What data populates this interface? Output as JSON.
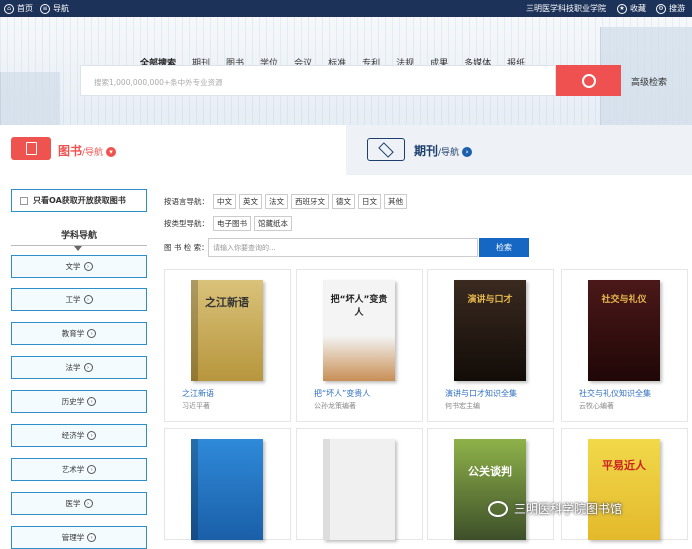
{
  "topbar": {
    "home": "首页",
    "nav": "导航",
    "school": "三明医学科技职业学院",
    "favorite": "收藏",
    "shortcut": "搜游"
  },
  "search": {
    "categories": [
      "全部搜索",
      "期刊",
      "图书",
      "学位",
      "会议",
      "标准",
      "专利",
      "法规",
      "成果",
      "多媒体",
      "报纸"
    ],
    "placeholder": "搜索1,000,000,000+条中外专业资源",
    "advanced": "高级检索"
  },
  "tabs": {
    "book_title": "图书",
    "book_sub": "/导航",
    "journal_title": "期刊",
    "journal_sub": "/导航"
  },
  "sidebar": {
    "oa_label": "只看OA获取开放获取图书",
    "subject_nav": "学科导航",
    "subjects": [
      "文学",
      "工学",
      "教育学",
      "法学",
      "历史学",
      "经济学",
      "艺术学",
      "医学",
      "管理学"
    ]
  },
  "filters": {
    "lang_label": "按语言导航：",
    "langs": [
      "中文",
      "英文",
      "法文",
      "西班牙文",
      "德文",
      "日文",
      "其他"
    ],
    "type_label": "按类型导航：",
    "types": [
      "电子图书",
      "馆藏纸本"
    ],
    "search_label": "图 书 检 索：",
    "search_placeholder": "请输入你要查询的...",
    "search_button": "检索"
  },
  "books": [
    {
      "title": "之江新语",
      "author": "习近平著",
      "cover": "之江新语"
    },
    {
      "title": "把“坏人”变贵人",
      "author": "公孙龙策编著",
      "cover": "把“坏人”变贵人"
    },
    {
      "title": "演讲与口才知识全集",
      "author": "何书宏主编",
      "cover": "演讲与口才"
    },
    {
      "title": "社交与礼仪知识全集",
      "author": "云牧心编著",
      "cover": "社交与礼仪"
    },
    {
      "title": "",
      "author": "",
      "cover": ""
    },
    {
      "title": "",
      "author": "",
      "cover": ""
    },
    {
      "title": "",
      "author": "",
      "cover": "公关谈判"
    },
    {
      "title": "",
      "author": "",
      "cover": "平易近人"
    }
  ],
  "watermark": "三明医科学院图书馆",
  "colors": {
    "topbar": "#1c3258",
    "accent_red": "#ef5350",
    "accent_blue": "#1666c3",
    "title_link": "#2c6ec0"
  }
}
